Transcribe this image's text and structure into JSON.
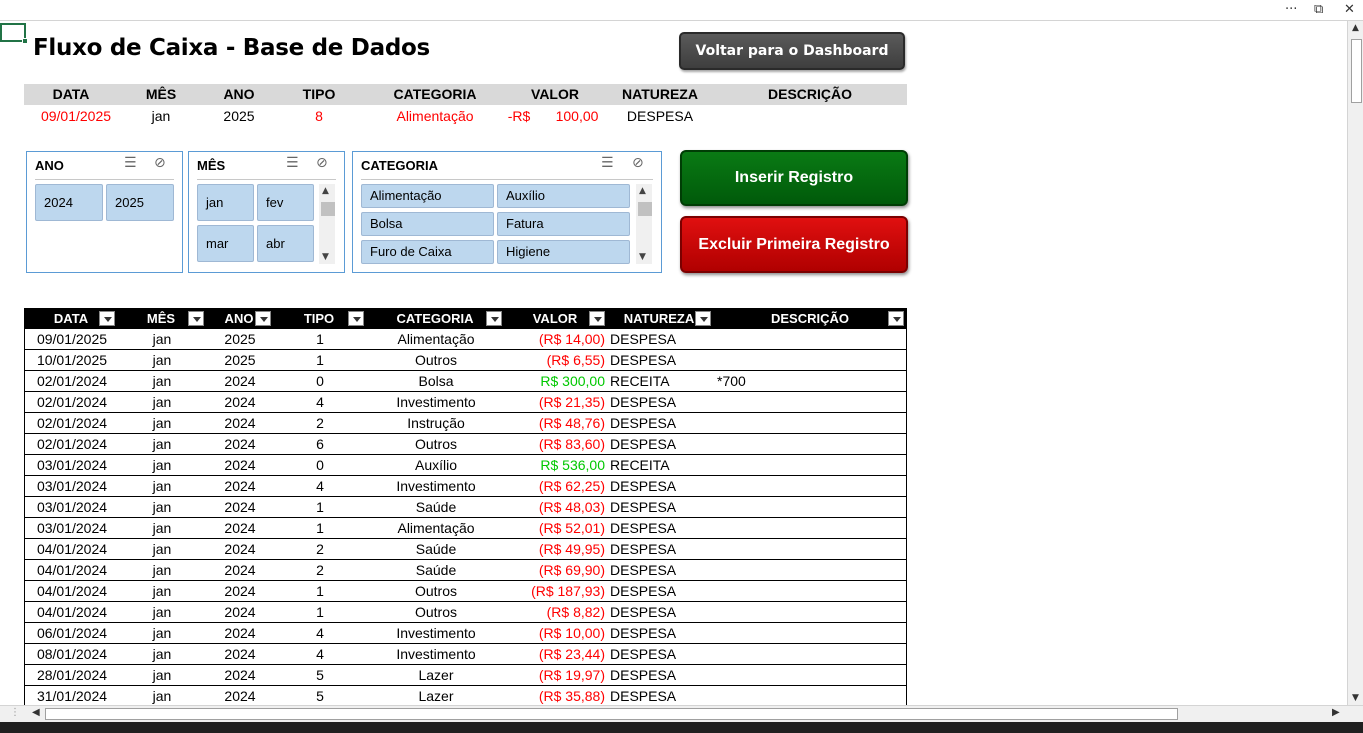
{
  "window": {
    "more_glyph": "···",
    "restore_glyph": "⧉",
    "close_glyph": "✕"
  },
  "title": "Fluxo de Caixa - Base de Dados",
  "dashboard_button": "Voltar para o Dashboard",
  "form": {
    "headers": [
      "DATA",
      "MÊS",
      "ANO",
      "TIPO",
      "CATEGORIA",
      "VALOR",
      "NATUREZA",
      "DESCRIÇÃO"
    ],
    "values": {
      "data": "09/01/2025",
      "mes": "jan",
      "ano": "2025",
      "tipo": "8",
      "categoria": "Alimentação",
      "valor_prefix": "-R$",
      "valor": "100,00",
      "natureza": "DESPESA"
    }
  },
  "slicers": {
    "ano": {
      "title": "ANO",
      "items": [
        "2024",
        "2025"
      ]
    },
    "mes": {
      "title": "MÊS",
      "items": [
        "jan",
        "fev",
        "mar",
        "abr"
      ]
    },
    "categoria": {
      "title": "CATEGORIA",
      "items": [
        "Alimentação",
        "Auxílio",
        "Bolsa",
        "Fatura",
        "Furo de Caixa",
        "Higiene"
      ]
    },
    "icons": {
      "multiselect": "☰",
      "clear_filter": "⊘"
    }
  },
  "buttons": {
    "insert": "Inserir Registro",
    "delete": "Excluir Primeira Registro"
  },
  "table": {
    "headers": [
      "DATA",
      "MÊS",
      "ANO",
      "TIPO",
      "CATEGORIA",
      "VALOR",
      "NATUREZA",
      "DESCRIÇÃO"
    ],
    "rows": [
      [
        "09/01/2025",
        "jan",
        "2025",
        "1",
        "Alimentação",
        "(R$ 14,00)",
        "DESPESA",
        ""
      ],
      [
        "10/01/2025",
        "jan",
        "2025",
        "1",
        "Outros",
        "(R$ 6,55)",
        "DESPESA",
        ""
      ],
      [
        "02/01/2024",
        "jan",
        "2024",
        "0",
        "Bolsa",
        "R$ 300,00",
        "RECEITA",
        "*700"
      ],
      [
        "02/01/2024",
        "jan",
        "2024",
        "4",
        "Investimento",
        "(R$ 21,35)",
        "DESPESA",
        ""
      ],
      [
        "02/01/2024",
        "jan",
        "2024",
        "2",
        "Instrução",
        "(R$ 48,76)",
        "DESPESA",
        ""
      ],
      [
        "02/01/2024",
        "jan",
        "2024",
        "6",
        "Outros",
        "(R$ 83,60)",
        "DESPESA",
        ""
      ],
      [
        "03/01/2024",
        "jan",
        "2024",
        "0",
        "Auxílio",
        "R$ 536,00",
        "RECEITA",
        ""
      ],
      [
        "03/01/2024",
        "jan",
        "2024",
        "4",
        "Investimento",
        "(R$ 62,25)",
        "DESPESA",
        ""
      ],
      [
        "03/01/2024",
        "jan",
        "2024",
        "1",
        "Saúde",
        "(R$ 48,03)",
        "DESPESA",
        ""
      ],
      [
        "03/01/2024",
        "jan",
        "2024",
        "1",
        "Alimentação",
        "(R$ 52,01)",
        "DESPESA",
        ""
      ],
      [
        "04/01/2024",
        "jan",
        "2024",
        "2",
        "Saúde",
        "(R$ 49,95)",
        "DESPESA",
        ""
      ],
      [
        "04/01/2024",
        "jan",
        "2024",
        "2",
        "Saúde",
        "(R$ 69,90)",
        "DESPESA",
        ""
      ],
      [
        "04/01/2024",
        "jan",
        "2024",
        "1",
        "Outros",
        "(R$ 187,93)",
        "DESPESA",
        ""
      ],
      [
        "04/01/2024",
        "jan",
        "2024",
        "1",
        "Outros",
        "(R$ 8,82)",
        "DESPESA",
        ""
      ],
      [
        "06/01/2024",
        "jan",
        "2024",
        "4",
        "Investimento",
        "(R$ 10,00)",
        "DESPESA",
        ""
      ],
      [
        "08/01/2024",
        "jan",
        "2024",
        "4",
        "Investimento",
        "(R$ 23,44)",
        "DESPESA",
        ""
      ],
      [
        "28/01/2024",
        "jan",
        "2024",
        "5",
        "Lazer",
        "(R$ 19,97)",
        "DESPESA",
        ""
      ],
      [
        "31/01/2024",
        "jan",
        "2024",
        "5",
        "Lazer",
        "(R$ 35,88)",
        "DESPESA",
        ""
      ]
    ]
  },
  "colors": {
    "expense": "#ff0000",
    "income": "#00c800",
    "form_red": "#ff0000"
  },
  "scroll": {
    "up": "▲",
    "down": "▼",
    "left": "◀",
    "right": "▶",
    "sheet_dots": "⋮"
  }
}
